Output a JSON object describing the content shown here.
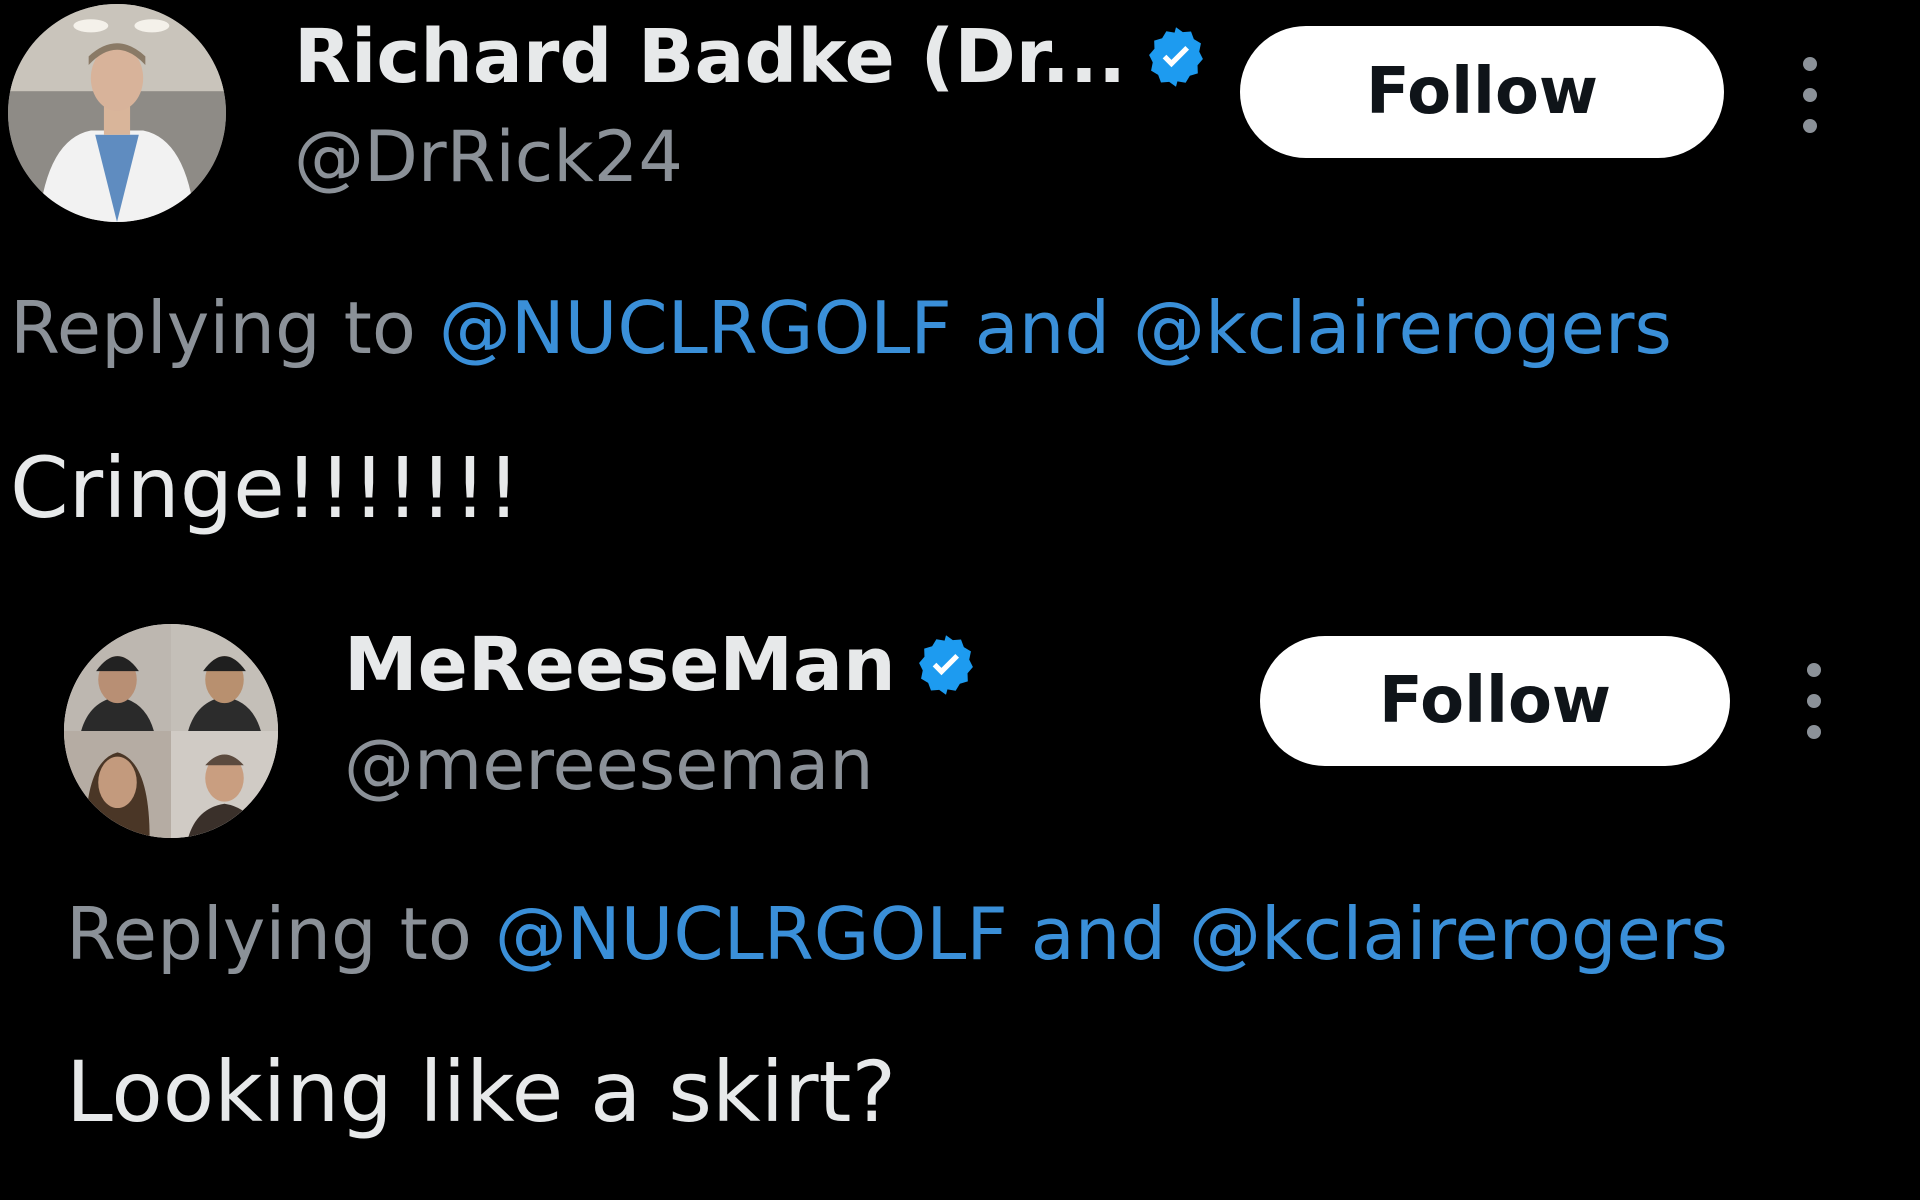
{
  "tweets": [
    {
      "display_name": "Richard Badke (Dr...",
      "handle": "@DrRick24",
      "follow_label": "Follow",
      "replying_prefix": "Replying to",
      "mention_1": "@NUCLRGOLF",
      "and_word": "and",
      "mention_2": "@kclairerogers",
      "text": "Cringe!!!!!!!",
      "verified": true,
      "avatar": "man-in-white-coat-avatar"
    },
    {
      "display_name": "MeReeseMan",
      "handle": "@mereeseman",
      "follow_label": "Follow",
      "replying_prefix": "Replying to",
      "mention_1": "@NUCLRGOLF",
      "and_word": "and",
      "mention_2": "@kclairerogers",
      "text": "Looking like a skirt?",
      "verified": true,
      "avatar": "four-faces-collage-avatar"
    }
  ],
  "colors": {
    "background": "#000000",
    "primary_text": "#e7e9ea",
    "secondary_text": "#8b9198",
    "link": "#3a8fd8",
    "verified_badge": "#1d9bf0",
    "button_bg": "#ffffff",
    "button_text": "#0f1419"
  },
  "icons": {
    "verified": "verified-badge-icon",
    "more": "more-options-icon"
  }
}
